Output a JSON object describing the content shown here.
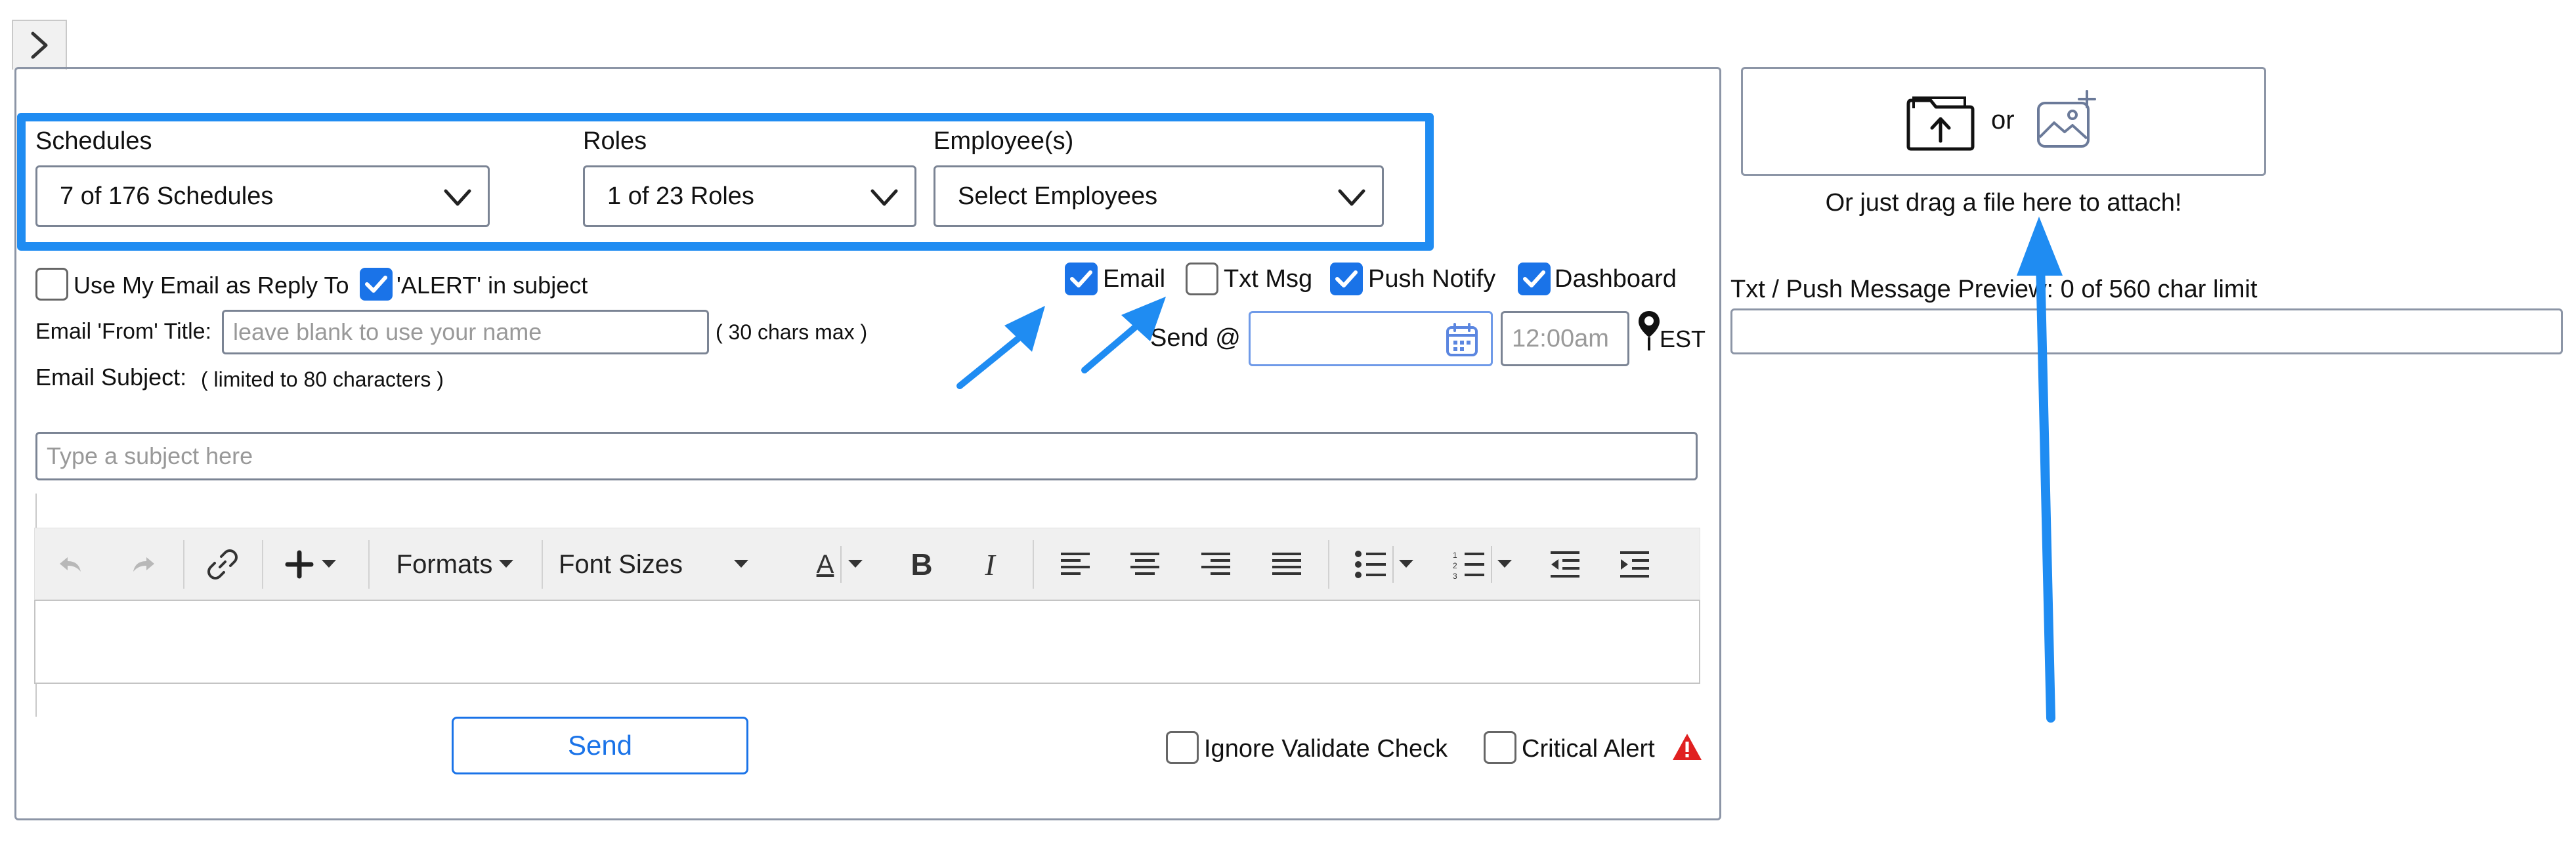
{
  "filters": {
    "schedules": {
      "label": "Schedules",
      "value": "7 of 176 Schedules"
    },
    "roles": {
      "label": "Roles",
      "value": "1 of 23 Roles"
    },
    "employees": {
      "label": "Employee(s)",
      "value": "Select Employees"
    }
  },
  "options": {
    "use_my_email": {
      "label": "Use My Email as Reply To",
      "checked": false
    },
    "alert_subject": {
      "label": "'ALERT' in subject",
      "checked": true
    }
  },
  "channels": [
    {
      "label": "Email",
      "checked": true
    },
    {
      "label": "Txt Msg",
      "checked": false
    },
    {
      "label": "Push Notify",
      "checked": true
    },
    {
      "label": "Dashboard",
      "checked": true
    }
  ],
  "from_title": {
    "label": "Email 'From' Title:",
    "placeholder": "leave blank to use your name",
    "hint": "( 30 chars max )"
  },
  "send_at": {
    "label": "Send @",
    "time_placeholder": "12:00am",
    "timezone": "EST"
  },
  "subject": {
    "label": "Email Subject:",
    "hint": "( limited to 80 characters )",
    "placeholder": "Type a subject here"
  },
  "toolbar": {
    "formats": "Formats",
    "font_sizes": "Font Sizes",
    "font_color_glyph": "A",
    "bold_glyph": "B",
    "italic_glyph": "I"
  },
  "actions": {
    "send": "Send",
    "ignore_validate": "Ignore Validate Check",
    "critical_alert": "Critical Alert"
  },
  "attach": {
    "or": "or",
    "drag_text": "Or just drag a file here to attach!"
  },
  "preview": {
    "label": "Txt / Push Message Preview: 0 of 560 char limit"
  },
  "colors": {
    "accent": "#1a73e8",
    "highlight": "#1f8cf2",
    "warning": "#e02020"
  }
}
